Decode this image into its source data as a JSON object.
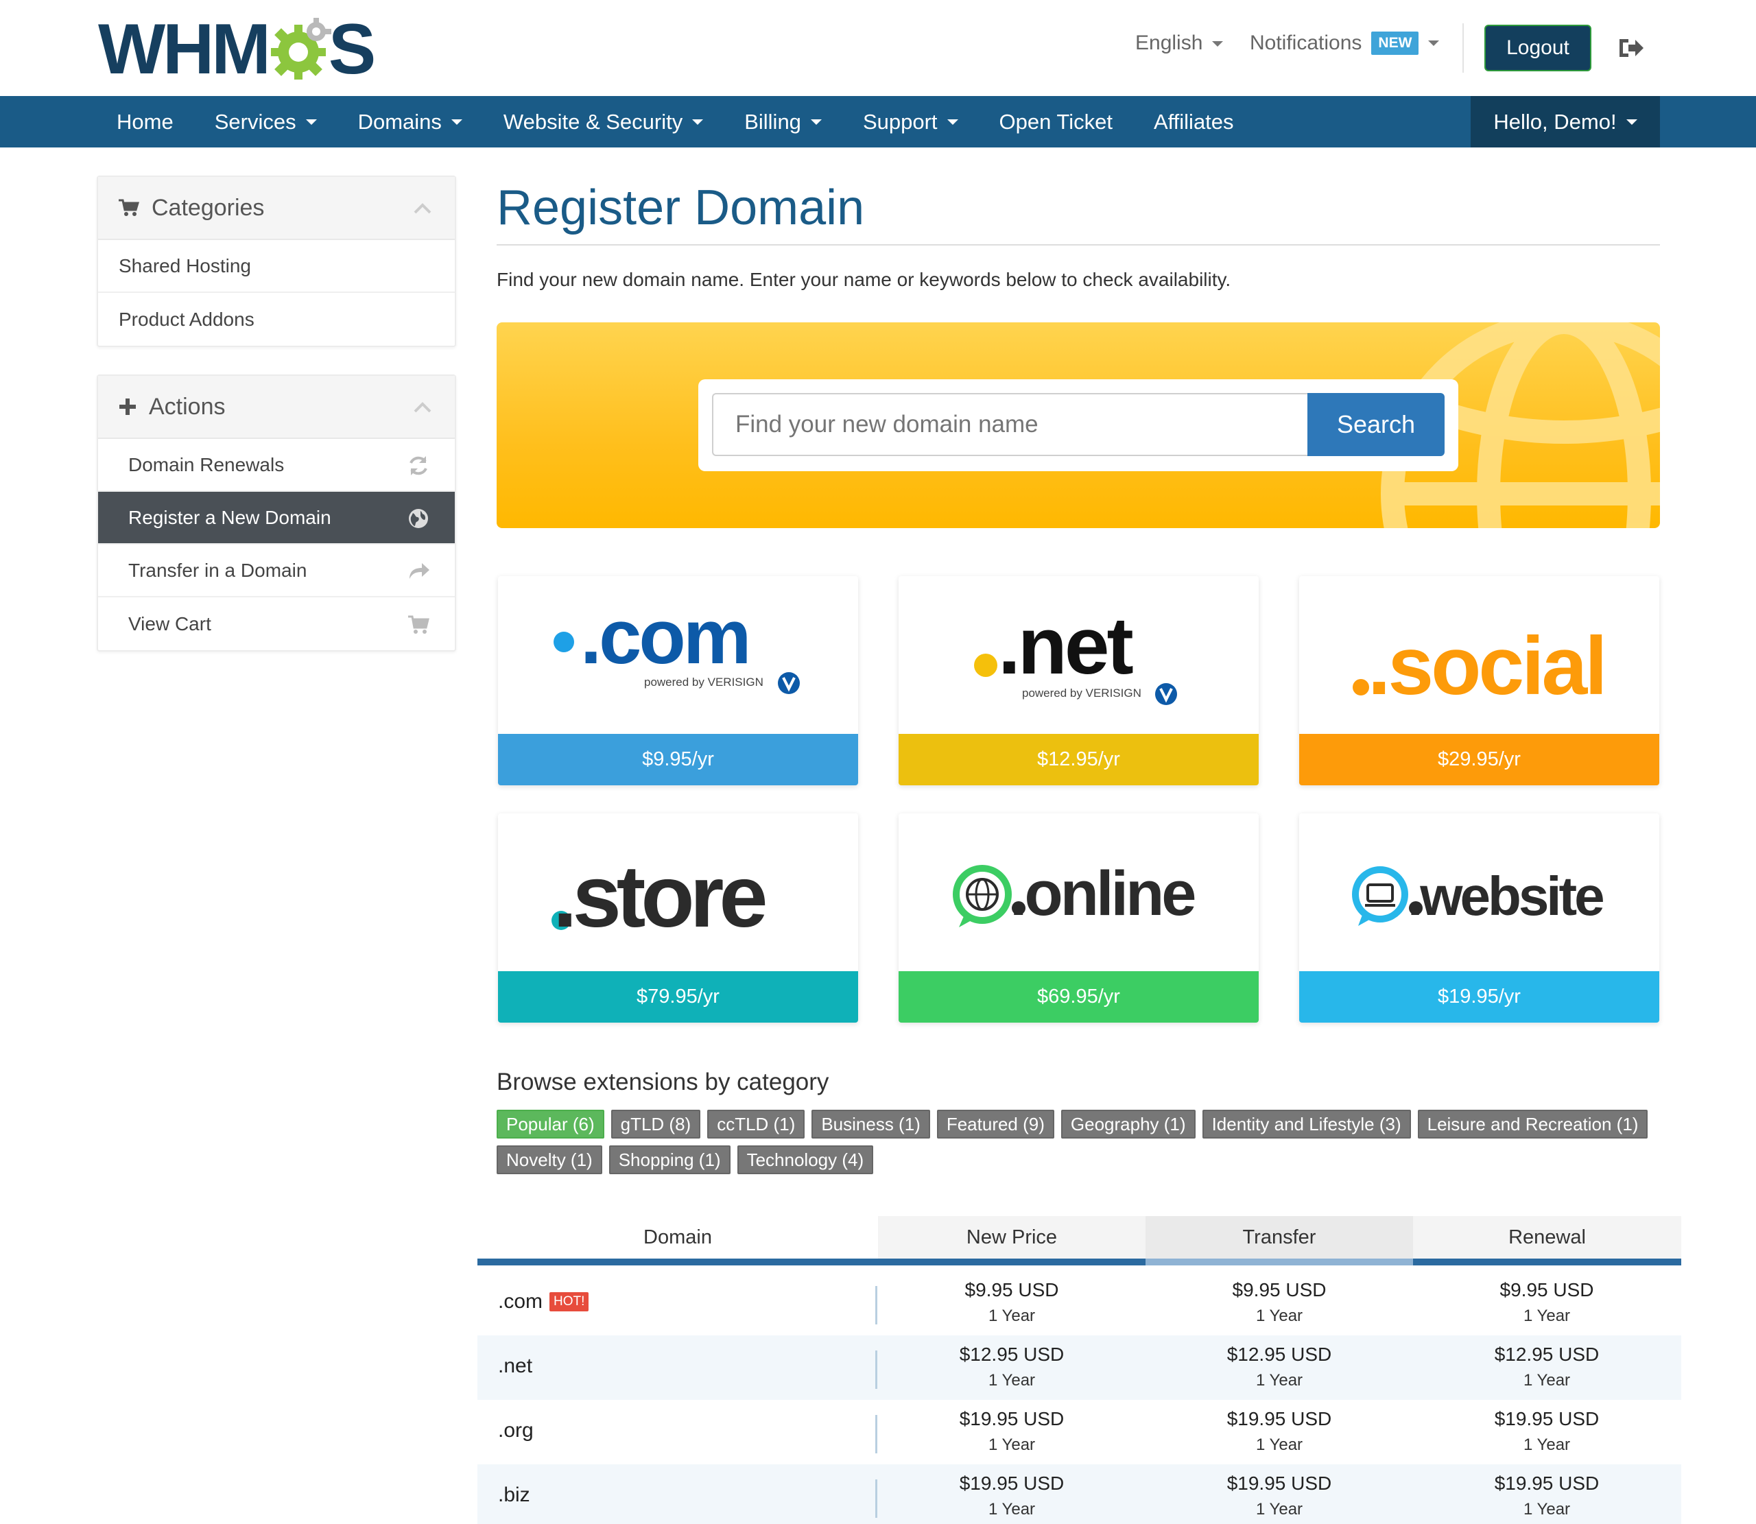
{
  "header": {
    "logo_left": "WHM",
    "logo_right": "S",
    "language": "English",
    "notifications": "Notifications",
    "notifications_badge": "NEW",
    "logout": "Logout"
  },
  "nav": {
    "items": [
      {
        "label": "Home",
        "dropdown": false
      },
      {
        "label": "Services",
        "dropdown": true
      },
      {
        "label": "Domains",
        "dropdown": true
      },
      {
        "label": "Website & Security",
        "dropdown": true
      },
      {
        "label": "Billing",
        "dropdown": true
      },
      {
        "label": "Support",
        "dropdown": true
      },
      {
        "label": "Open Ticket",
        "dropdown": false
      },
      {
        "label": "Affiliates",
        "dropdown": false
      }
    ],
    "user": "Hello, Demo!"
  },
  "sidebar": {
    "categories": {
      "title": "Categories",
      "items": [
        "Shared Hosting",
        "Product Addons"
      ]
    },
    "actions": {
      "title": "Actions",
      "items": [
        {
          "label": "Domain Renewals",
          "icon": "refresh-icon",
          "active": false
        },
        {
          "label": "Register a New Domain",
          "icon": "globe-icon",
          "active": true
        },
        {
          "label": "Transfer in a Domain",
          "icon": "share-arrow-icon",
          "active": false
        },
        {
          "label": "View Cart",
          "icon": "cart-icon",
          "active": false
        }
      ]
    }
  },
  "main": {
    "title": "Register Domain",
    "intro": "Find your new domain name. Enter your name or keywords below to check availability.",
    "search": {
      "placeholder": "Find your new domain name",
      "button": "Search"
    }
  },
  "featured": [
    {
      "tld": "com",
      "price": "$9.95/yr",
      "color": "#3b9fdc",
      "sub": "powered by VERISIGN"
    },
    {
      "tld": "net",
      "price": "$12.95/yr",
      "color": "#ecc00f",
      "sub": "powered by VERISIGN"
    },
    {
      "tld": "social",
      "price": "$29.95/yr",
      "color": "#fd9b0a"
    },
    {
      "tld": "store",
      "price": "$79.95/yr",
      "color": "#0fb1b8"
    },
    {
      "tld": "online",
      "price": "$69.95/yr",
      "color": "#3ccd63"
    },
    {
      "tld": "website",
      "price": "$19.95/yr",
      "color": "#28b7ea"
    }
  ],
  "browse": {
    "title": "Browse extensions by category",
    "rows": [
      [
        {
          "label": "Popular (6)",
          "active": true
        },
        {
          "label": "gTLD (8)",
          "active": false
        },
        {
          "label": "ccTLD (1)",
          "active": false
        },
        {
          "label": "Business (1)",
          "active": false
        },
        {
          "label": "Featured (9)",
          "active": false
        },
        {
          "label": "Geography (1)",
          "active": false
        },
        {
          "label": "Identity and Lifestyle (3)",
          "active": false
        },
        {
          "label": "Leisure and Recreation (1)",
          "active": false
        }
      ],
      [
        {
          "label": "Novelty (1)",
          "active": false
        },
        {
          "label": "Shopping (1)",
          "active": false
        },
        {
          "label": "Technology (4)",
          "active": false
        }
      ]
    ]
  },
  "pricing": {
    "headers": [
      "Domain",
      "New Price",
      "Transfer",
      "Renewal"
    ],
    "rows": [
      {
        "tld": ".com",
        "hot": "HOT!",
        "new": "$9.95 USD",
        "transfer": "$9.95 USD",
        "renewal": "$9.95 USD",
        "period": "1 Year"
      },
      {
        "tld": ".net",
        "new": "$12.95 USD",
        "transfer": "$12.95 USD",
        "renewal": "$12.95 USD",
        "period": "1 Year"
      },
      {
        "tld": ".org",
        "new": "$19.95 USD",
        "transfer": "$19.95 USD",
        "renewal": "$19.95 USD",
        "period": "1 Year"
      },
      {
        "tld": ".biz",
        "new": "$19.95 USD",
        "transfer": "$19.95 USD",
        "renewal": "$19.95 USD",
        "period": "1 Year"
      }
    ]
  }
}
